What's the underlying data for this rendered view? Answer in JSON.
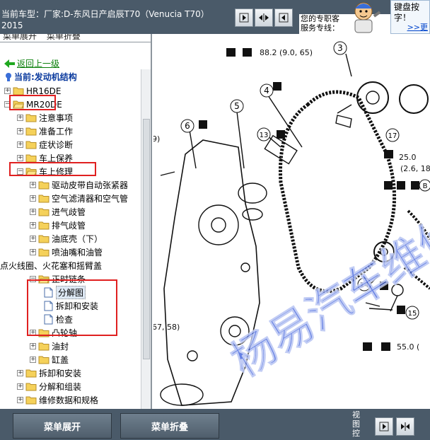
{
  "header": {
    "car_info": "当前车型：厂家:D-东风日产启辰T70（Venucia T70）2015",
    "service_line1": "您的专职客",
    "service_line2": "服务专线：",
    "tip_text": "键盘按字！",
    "tip_more": ">>更",
    "nav_icons": [
      "prev-icon",
      "split-view-icon",
      "next-icon"
    ]
  },
  "left_panel": {
    "tabs": [
      "菜单展开",
      "菜单折叠"
    ],
    "back_label": "返回上一级",
    "current_label": "当前:发动机结构",
    "tree": [
      {
        "id": "hr16de",
        "label": "HR16DE",
        "level": 0,
        "expander": "+"
      },
      {
        "id": "mr20de",
        "label": "MR20DE",
        "level": 0,
        "expander": "-",
        "highlight": true
      },
      {
        "id": "notes",
        "label": "注意事项",
        "level": 1,
        "expander": "+"
      },
      {
        "id": "prep",
        "label": "准备工作",
        "level": 1,
        "expander": "+"
      },
      {
        "id": "diag",
        "label": "症状诊断",
        "level": 1,
        "expander": "+"
      },
      {
        "id": "maint",
        "label": "车上保养",
        "level": 1,
        "expander": "+"
      },
      {
        "id": "repair",
        "label": "车上修理",
        "level": 1,
        "expander": "-",
        "highlight": true
      },
      {
        "id": "belt",
        "label": "驱动皮带自动张紧器",
        "level": 2,
        "expander": "+"
      },
      {
        "id": "airfilter",
        "label": "空气滤清器和空气管",
        "level": 2,
        "expander": "+"
      },
      {
        "id": "intake",
        "label": "进气歧管",
        "level": 2,
        "expander": "+"
      },
      {
        "id": "exhaust",
        "label": "排气歧管",
        "level": 2,
        "expander": "+"
      },
      {
        "id": "oilpan",
        "label": "油底壳（下）",
        "level": 2,
        "expander": "+"
      },
      {
        "id": "injector",
        "label": "喷油嘴和油管",
        "level": 2,
        "expander": "+"
      },
      {
        "id": "ignition",
        "label": "点火线圈、火花塞和摇臂盖",
        "level": 2,
        "expander": "+"
      },
      {
        "id": "chain",
        "label": "正时链条",
        "level": 2,
        "expander": "-",
        "highlight": true
      },
      {
        "id": "exploded",
        "label": "分解图",
        "level": 3,
        "doc": true,
        "selected": true
      },
      {
        "id": "removal",
        "label": "拆卸和安装",
        "level": 3,
        "doc": true
      },
      {
        "id": "inspect",
        "label": "检查",
        "level": 3,
        "doc": true
      },
      {
        "id": "camshaft",
        "label": "凸轮轴",
        "level": 2,
        "expander": "+"
      },
      {
        "id": "oilseal",
        "label": "油封",
        "level": 2,
        "expander": "+"
      },
      {
        "id": "cylhead",
        "label": "缸盖",
        "level": 2,
        "expander": "+"
      },
      {
        "id": "removal2",
        "label": "拆卸和安装",
        "level": 1,
        "expander": "+"
      },
      {
        "id": "disasm",
        "label": "分解和组装",
        "level": 1,
        "expander": "+"
      },
      {
        "id": "more",
        "label": "维修数据和规格",
        "level": 1,
        "expander": "+"
      }
    ]
  },
  "diagram": {
    "torque1": "88.2 (9.0, 65)",
    "torque2": "25.0",
    "torque2b": "(2.6, 18",
    "torque3": "55.0 (",
    "left_value1": "9)",
    "left_value2": "67, 58)",
    "callouts": [
      "3",
      "4",
      "5",
      "6",
      "13",
      "14",
      "15",
      "17"
    ],
    "letter_mark": "B",
    "watermark": "杨易汽车维修"
  },
  "footer": {
    "expand_label": "菜单展开",
    "collapse_label": "菜单折叠",
    "view_label": "视图控",
    "nav_icons": [
      "next-icon",
      "split-view-icon"
    ]
  },
  "colors": {
    "header_bg": "#4a5a69",
    "highlight_red": "#e02020",
    "watermark": "#2a4fd8",
    "link_green": "#0a7f0a"
  }
}
